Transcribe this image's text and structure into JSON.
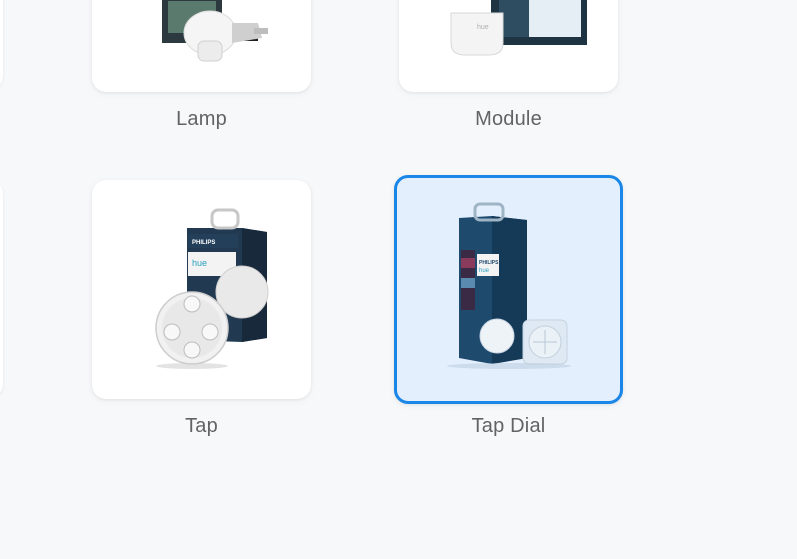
{
  "grid": {
    "tiles": [
      {
        "label": "Lamp",
        "icon": "hue-lamp-product-icon",
        "selected": false
      },
      {
        "label": "Module",
        "icon": "wall-switch-module-product-icon",
        "selected": false
      },
      {
        "label": "Tap",
        "icon": "hue-tap-product-icon",
        "selected": false
      },
      {
        "label": "Tap Dial",
        "icon": "tap-dial-product-icon",
        "selected": true
      }
    ]
  },
  "colors": {
    "background": "#f7f8fa",
    "card": "#ffffff",
    "selected_fill": "#e3effc",
    "selected_border": "#1a86e8",
    "label": "#636363"
  }
}
